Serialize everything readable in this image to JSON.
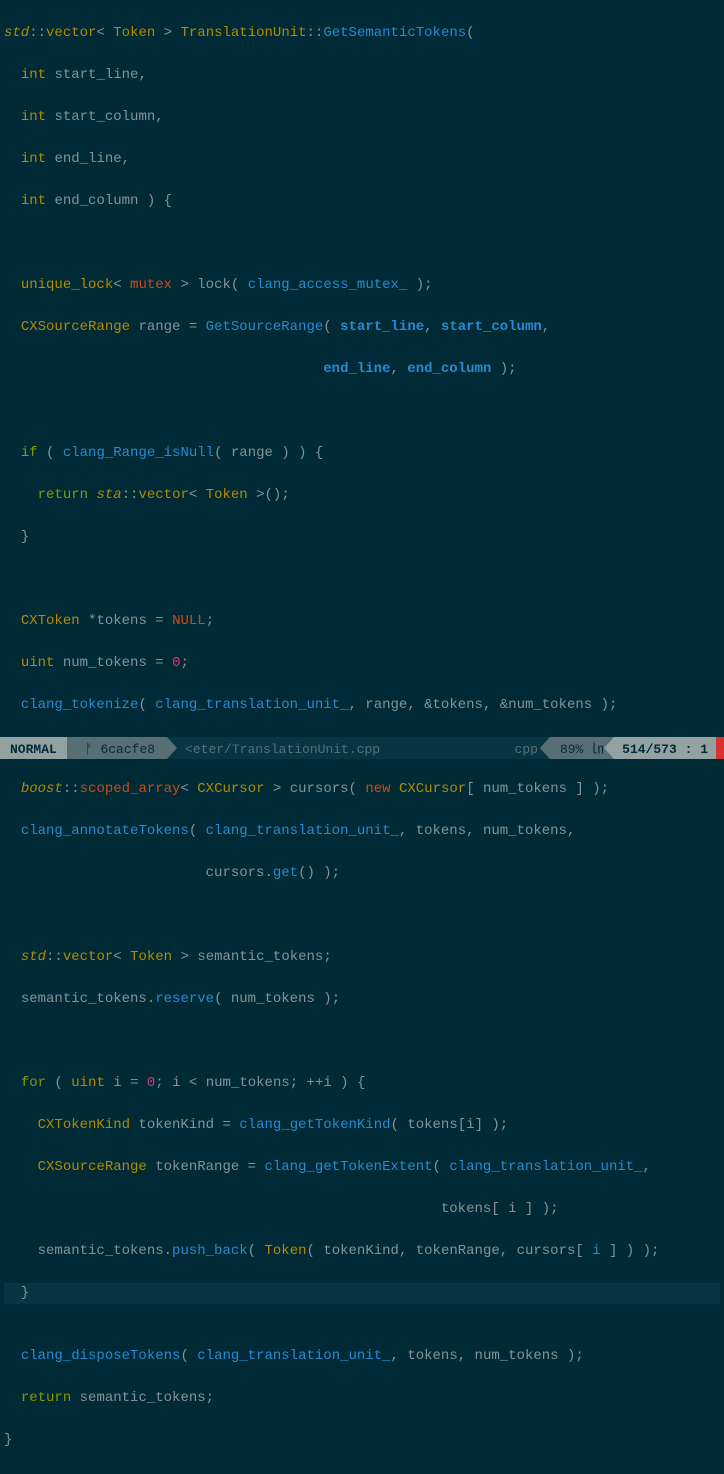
{
  "code": {
    "l1_std": "std",
    "l1_vector": "vector",
    "l1_Token": "Token",
    "l1_TU": "TranslationUnit",
    "l1_fn": "GetSemanticTokens",
    "l2_int": "int",
    "l2_p": "start_line",
    "l3_int": "int",
    "l3_p": "start_column",
    "l4_int": "int",
    "l4_p": "end_line",
    "l5_int": "int",
    "l5_p": "end_column",
    "l7_ul": "unique_lock",
    "l7_mutex": "mutex",
    "l7_lock": "lock",
    "l7_mx": "clang_access_mutex_",
    "l8_CXSR": "CXSourceRange",
    "l8_range": "range",
    "l8_GSR": "GetSourceRange",
    "l8_a1": "start_line",
    "l8_a2": "start_column",
    "l9_a3": "end_line",
    "l9_a4": "end_column",
    "l11_if": "if",
    "l11_cRIN": "clang_Range_isNull",
    "l11_range": "range",
    "l12_return": "return",
    "l12_sta": "sta",
    "l12_vector": "vector",
    "l12_Token": "Token",
    "l15_CXToken": "CXToken",
    "l15_tokens": "tokens",
    "l15_NULL": "NULL",
    "l16_uint": "uint",
    "l16_nt": "num_tokens",
    "l16_zero": "0",
    "l17_ct": "clang_tokenize",
    "l17_ctu": "clang_translation_unit_",
    "l17_r": "range",
    "l17_t": "tokens",
    "l17_nt": "num_tokens",
    "l19_boost": "boost",
    "l19_sa": "scoped_array",
    "l19_CXC": "CXCursor",
    "l19_curs": "cursors",
    "l19_new": "new",
    "l19_CXC2": "CXCursor",
    "l19_nt": "num_tokens",
    "l20_cat": "clang_annotateTokens",
    "l20_ctu": "clang_translation_unit_",
    "l20_t": "tokens",
    "l20_nt": "num_tokens",
    "l21_curs": "cursors",
    "l21_get": "get",
    "l23_std": "std",
    "l23_vector": "vector",
    "l23_Token": "Token",
    "l23_st": "semantic_tokens",
    "l24_st": "semantic_tokens",
    "l24_reserve": "reserve",
    "l24_nt": "num_tokens",
    "l26_for": "for",
    "l26_uint": "uint",
    "l26_i": "i",
    "l26_zero": "0",
    "l26_i2": "i",
    "l26_nt": "num_tokens",
    "l26_i3": "i",
    "l27_CXTK": "CXTokenKind",
    "l27_tk": "tokenKind",
    "l27_cgtk": "clang_getTokenKind",
    "l27_t": "tokens",
    "l27_i": "i",
    "l28_CXSR": "CXSourceRange",
    "l28_tr": "tokenRange",
    "l28_cgte": "clang_getTokenExtent",
    "l28_ctu": "clang_translation_unit_",
    "l29_t": "tokens",
    "l29_i": "i",
    "l30_st": "semantic_tokens",
    "l30_pb": "push_back",
    "l30_Tok": "Token",
    "l30_tk": "tokenKind",
    "l30_tr": "tokenRange",
    "l30_c": "cursors",
    "l30_i": "i",
    "l33_cdt": "clang_disposeTokens",
    "l33_ctu": "clang_translation_unit_",
    "l33_t": "tokens",
    "l33_nt": "num_tokens",
    "l34_return": "return",
    "l34_st": "semantic_tokens"
  },
  "statusbar": {
    "mode": "NORMAL",
    "git_icon": "ᚠ",
    "git": "6cacfe8",
    "file": "<eter/TranslationUnit.cpp",
    "filetype": "cpp",
    "percent": "89%",
    "ln_icon": "㏑",
    "position": "514/573",
    "col": "1"
  }
}
